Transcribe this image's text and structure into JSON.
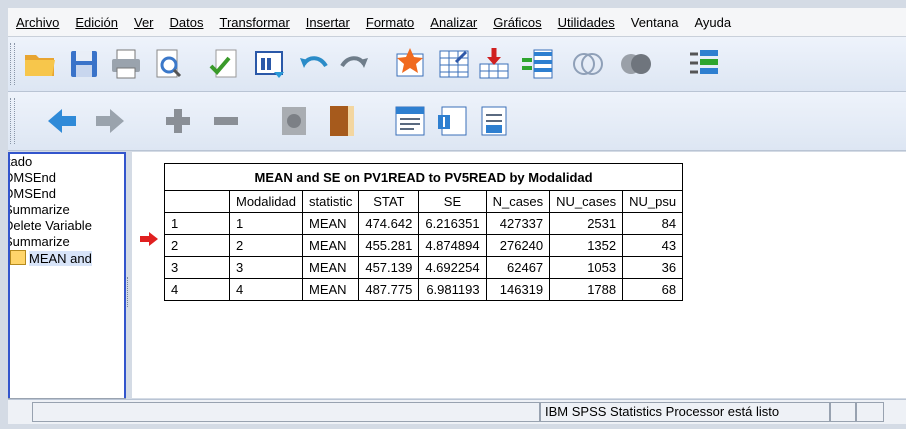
{
  "menu": [
    "Archivo",
    "Edición",
    "Ver",
    "Datos",
    "Transformar",
    "Insertar",
    "Formato",
    "Analizar",
    "Gráficos",
    "Utilidades",
    "Ventana",
    "Ayuda"
  ],
  "toolbar1_icons": [
    "open-folder-icon",
    "save-disk-icon",
    "print-icon",
    "print-preview-icon",
    "export-icon",
    "recall-dialog-icon",
    "undo-icon",
    "redo-icon",
    "goto-data-icon",
    "goto-case-icon",
    "insert-variable-icon",
    "split-file-icon",
    "venn-select-icon",
    "gray-circles-icon",
    "variables-sets-icon"
  ],
  "toolbar2_icons": [
    "back-arrow-icon",
    "forward-arrow-icon",
    "expand-plus-icon",
    "collapse-minus-icon",
    "show-icon",
    "hide-book-icon",
    "insert-heading-icon",
    "insert-title-icon",
    "insert-text-icon"
  ],
  "outline": {
    "items": [
      "ltado",
      "DMSEnd",
      "DMSEnd",
      "Summarize",
      "Delete Variable",
      "Summarize",
      "MEAN and"
    ]
  },
  "table": {
    "title": "MEAN and SE on PV1READ to PV5READ by Modalidad",
    "headers": [
      "",
      "Modalidad",
      "statistic",
      "STAT",
      "SE",
      "N_cases",
      "NU_cases",
      "NU_psu"
    ],
    "rows": [
      [
        "1",
        "1",
        "MEAN",
        "474.642",
        "6.216351",
        "427337",
        "2531",
        "84"
      ],
      [
        "2",
        "2",
        "MEAN",
        "455.281",
        "4.874894",
        "276240",
        "1352",
        "43"
      ],
      [
        "3",
        "3",
        "MEAN",
        "457.139",
        "4.692254",
        "62467",
        "1053",
        "36"
      ],
      [
        "4",
        "4",
        "MEAN",
        "487.775",
        "6.981193",
        "146319",
        "1788",
        "68"
      ]
    ]
  },
  "status": {
    "processor": "IBM SPSS Statistics Processor está listo"
  },
  "colors": {
    "accent": "#3355cc",
    "selection_arrow": "#e02020"
  }
}
